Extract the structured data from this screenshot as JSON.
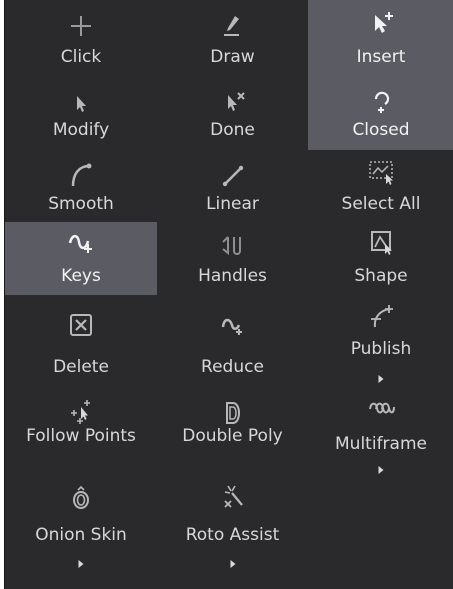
{
  "tools": {
    "click": {
      "label": "Click",
      "icon": "plus-icon"
    },
    "draw": {
      "label": "Draw",
      "icon": "pen-icon"
    },
    "insert": {
      "label": "Insert",
      "icon": "cursor-plus-icon"
    },
    "modify": {
      "label": "Modify",
      "icon": "cursor-icon"
    },
    "done": {
      "label": "Done",
      "icon": "cursor-x-icon"
    },
    "closed": {
      "label": "Closed",
      "icon": "closed-loop-icon"
    },
    "smooth": {
      "label": "Smooth",
      "icon": "smooth-curve-icon"
    },
    "linear": {
      "label": "Linear",
      "icon": "linear-line-icon"
    },
    "select_all": {
      "label": "Select All",
      "icon": "select-all-icon"
    },
    "keys": {
      "label": "Keys",
      "icon": "keys-curve-icon"
    },
    "handles": {
      "label": "Handles",
      "icon": "handles-icon"
    },
    "shape": {
      "label": "Shape",
      "icon": "shape-icon"
    },
    "delete": {
      "label": "Delete",
      "icon": "delete-box-icon"
    },
    "reduce": {
      "label": "Reduce",
      "icon": "reduce-icon"
    },
    "publish": {
      "label": "Publish",
      "icon": "publish-icon"
    },
    "follow_points": {
      "label": "Follow Points",
      "icon": "follow-points-icon"
    },
    "double_poly": {
      "label": "Double Poly",
      "icon": "double-poly-icon"
    },
    "multiframe": {
      "label": "Multiframe",
      "icon": "multiframe-icon"
    },
    "onion_skin": {
      "label": "Onion Skin",
      "icon": "onion-skin-icon"
    },
    "roto_assist": {
      "label": "Roto Assist",
      "icon": "roto-assist-icon"
    }
  },
  "colors": {
    "panel_bg": "#2a2a2d",
    "active_bg": "#5b5b63",
    "text": "#d8d8d8"
  }
}
